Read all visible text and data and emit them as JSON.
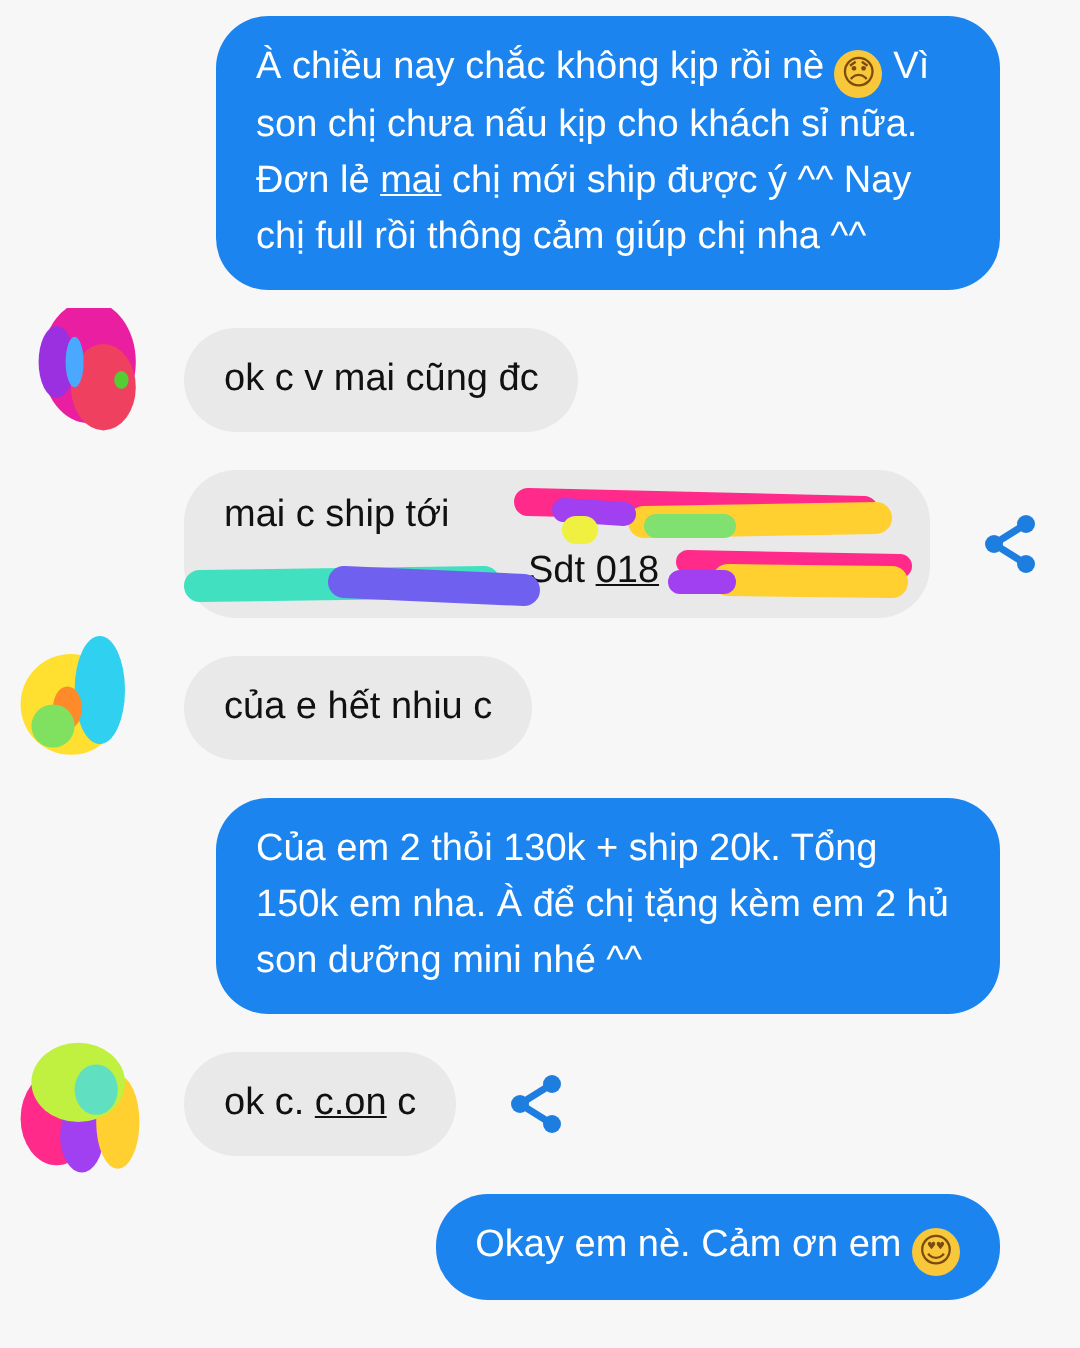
{
  "messages": [
    {
      "kind": "sent",
      "avatar": false,
      "share": false,
      "redacted": false,
      "lines": [
        [
          {
            "kind": "text",
            "text": "À chiều nay chắc không kịp rồi nè "
          },
          {
            "kind": "emoji",
            "text": "😞"
          },
          {
            "kind": "text",
            "text": " Vì son chị chưa nấu kịp cho khách sỉ nữa. Đơn lẻ "
          },
          {
            "kind": "link",
            "text": "mai"
          },
          {
            "kind": "text",
            "text": " chị mới ship được ý ^^ Nay chị full rồi thông cảm giúp chị nha ^^"
          }
        ]
      ]
    },
    {
      "kind": "received",
      "avatar": true,
      "share": false,
      "redacted": false,
      "lines": [
        [
          {
            "kind": "text",
            "text": "ok c v mai cũng đc"
          }
        ]
      ]
    },
    {
      "kind": "received",
      "avatar": false,
      "share": true,
      "redacted": true,
      "lines": [
        [
          {
            "kind": "text",
            "text": "mai c ship tới"
          }
        ],
        [
          {
            "kind": "text",
            "text": "Sdt "
          },
          {
            "kind": "link",
            "text": "018"
          }
        ]
      ]
    },
    {
      "kind": "received",
      "avatar": true,
      "share": false,
      "redacted": false,
      "lines": [
        [
          {
            "kind": "text",
            "text": "của e hết nhiu c"
          }
        ]
      ]
    },
    {
      "kind": "sent",
      "avatar": false,
      "share": false,
      "redacted": false,
      "lines": [
        [
          {
            "kind": "text",
            "text": "Của em 2 thỏi 130k + ship 20k. Tổng 150k em nha. À để chị tặng kèm em 2 hủ son dưỡng mini nhé ^^"
          }
        ]
      ]
    },
    {
      "kind": "received",
      "avatar": true,
      "share": true,
      "redacted": false,
      "lines": [
        [
          {
            "kind": "text",
            "text": "ok c. "
          },
          {
            "kind": "link",
            "text": "c.on"
          },
          {
            "kind": "text",
            "text": " c"
          }
        ]
      ]
    },
    {
      "kind": "sent",
      "avatar": false,
      "share": false,
      "redacted": false,
      "lines": [
        [
          {
            "kind": "text",
            "text": "Okay em nè. Cảm ơn em "
          },
          {
            "kind": "emoji",
            "text": "😍"
          }
        ]
      ]
    }
  ]
}
